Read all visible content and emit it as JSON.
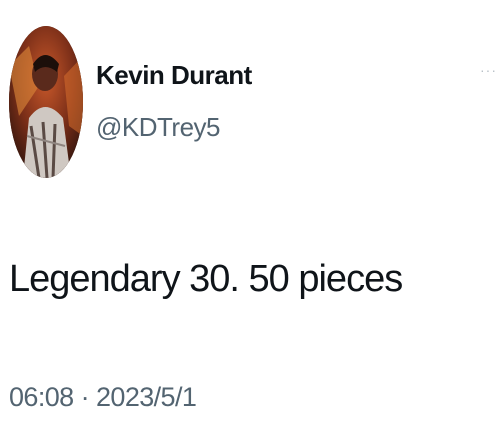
{
  "author": {
    "display_name": "Kevin Durant",
    "handle": "@KDTrey5",
    "avatar_icon": "profile-photo"
  },
  "more_icon": "ellipsis-icon",
  "tweet": {
    "text": "Legendary 30. 50 pieces",
    "time": "06:08",
    "separator": "·",
    "date": "2023/5/1"
  },
  "colors": {
    "primary_text": "#0f1419",
    "secondary_text": "#536471",
    "background": "#ffffff"
  }
}
